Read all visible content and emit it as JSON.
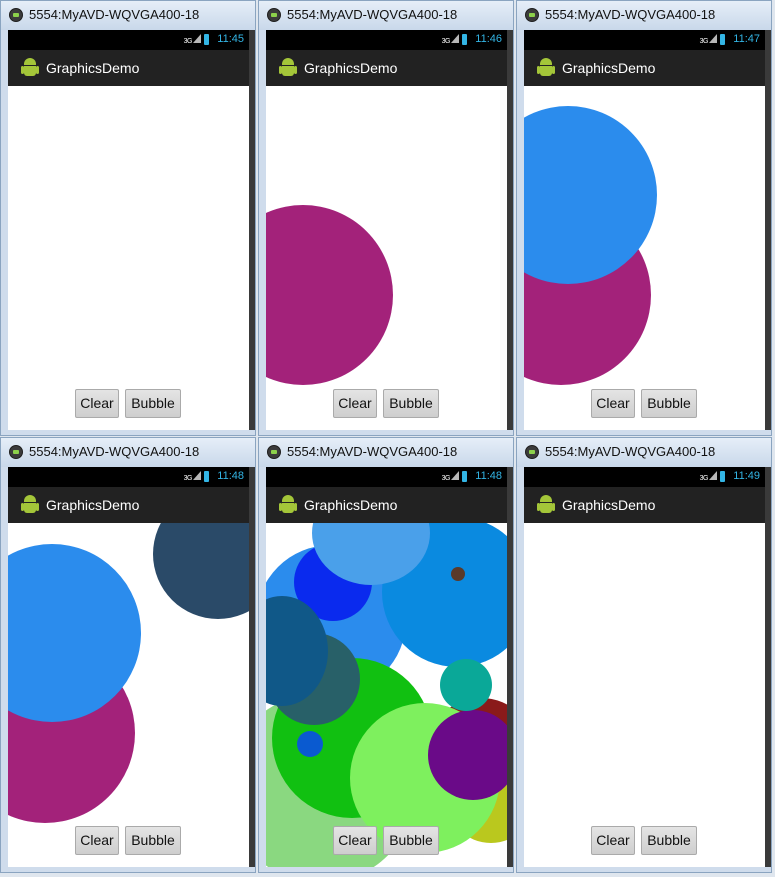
{
  "window_title": "5554:MyAVD-WQVGA400-18",
  "app_title": "GraphicsDemo",
  "signal_label": "3G",
  "buttons": {
    "clear": "Clear",
    "bubble": "Bubble"
  },
  "screens": [
    {
      "time": "11:45"
    },
    {
      "time": "11:46"
    },
    {
      "time": "11:47"
    },
    {
      "time": "11:48"
    },
    {
      "time": "11:48"
    },
    {
      "time": "11:49"
    }
  ],
  "colors": {
    "magenta": "#a3227a",
    "blue": "#2b8ced",
    "slate": "#2a4a68",
    "royal": "#0a2aee",
    "lightblue": "#4aa0ea",
    "azure": "#0a8ae0",
    "green": "#11c011",
    "lightgreen": "#7ef05e",
    "teal": "#0aa898",
    "purple": "#6a0a88",
    "darkred": "#8a1a1a",
    "olive": "#bac81e"
  }
}
